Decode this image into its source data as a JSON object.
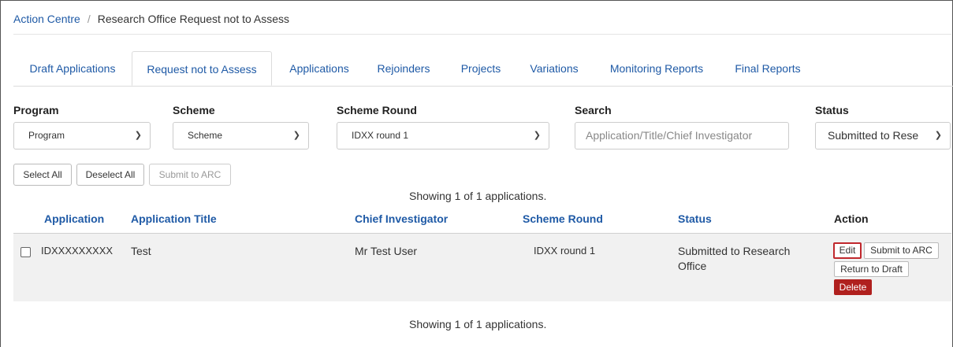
{
  "breadcrumb": {
    "root": "Action Centre",
    "separator": "/",
    "current": "Research Office Request not to Assess"
  },
  "tabs": [
    {
      "label": "Draft Applications"
    },
    {
      "label": "Request not to Assess"
    },
    {
      "label": "Applications"
    },
    {
      "label": "Rejoinders"
    },
    {
      "label": "Projects"
    },
    {
      "label": "Variations"
    },
    {
      "label": "Monitoring Reports"
    },
    {
      "label": "Final Reports"
    }
  ],
  "filters": {
    "program": {
      "label": "Program",
      "value": "Program"
    },
    "scheme": {
      "label": "Scheme",
      "value": "Scheme"
    },
    "scheme_round": {
      "label": "Scheme Round",
      "value": "IDXX round 1"
    },
    "search": {
      "label": "Search",
      "placeholder": "Application/Title/Chief Investigator"
    },
    "status": {
      "label": "Status",
      "value": "Submitted to Rese"
    }
  },
  "bulk_actions": {
    "select_all": "Select All",
    "deselect_all": "Deselect All",
    "submit": "Submit to ARC"
  },
  "summary_top": "Showing 1 of 1 applications.",
  "summary_bottom": "Showing 1 of 1 applications.",
  "table": {
    "headers": {
      "application": "Application",
      "title": "Application Title",
      "ci": "Chief Investigator",
      "round": "Scheme Round",
      "status": "Status",
      "action": "Action"
    },
    "rows": [
      {
        "application": "IDXXXXXXXXX",
        "title": "Test",
        "ci": "Mr Test User",
        "round": "IDXX round 1",
        "status_line1": "Submitted to Research",
        "status_line2": "Office",
        "actions": {
          "edit": "Edit",
          "submit": "Submit to ARC",
          "return": "Return to Draft",
          "delete": "Delete"
        }
      }
    ]
  },
  "colors": {
    "link": "#1f5aa6",
    "danger": "#b0201e",
    "row_bg": "#f1f1f1"
  },
  "icons": {
    "dropdown": "chevron-down-icon"
  }
}
